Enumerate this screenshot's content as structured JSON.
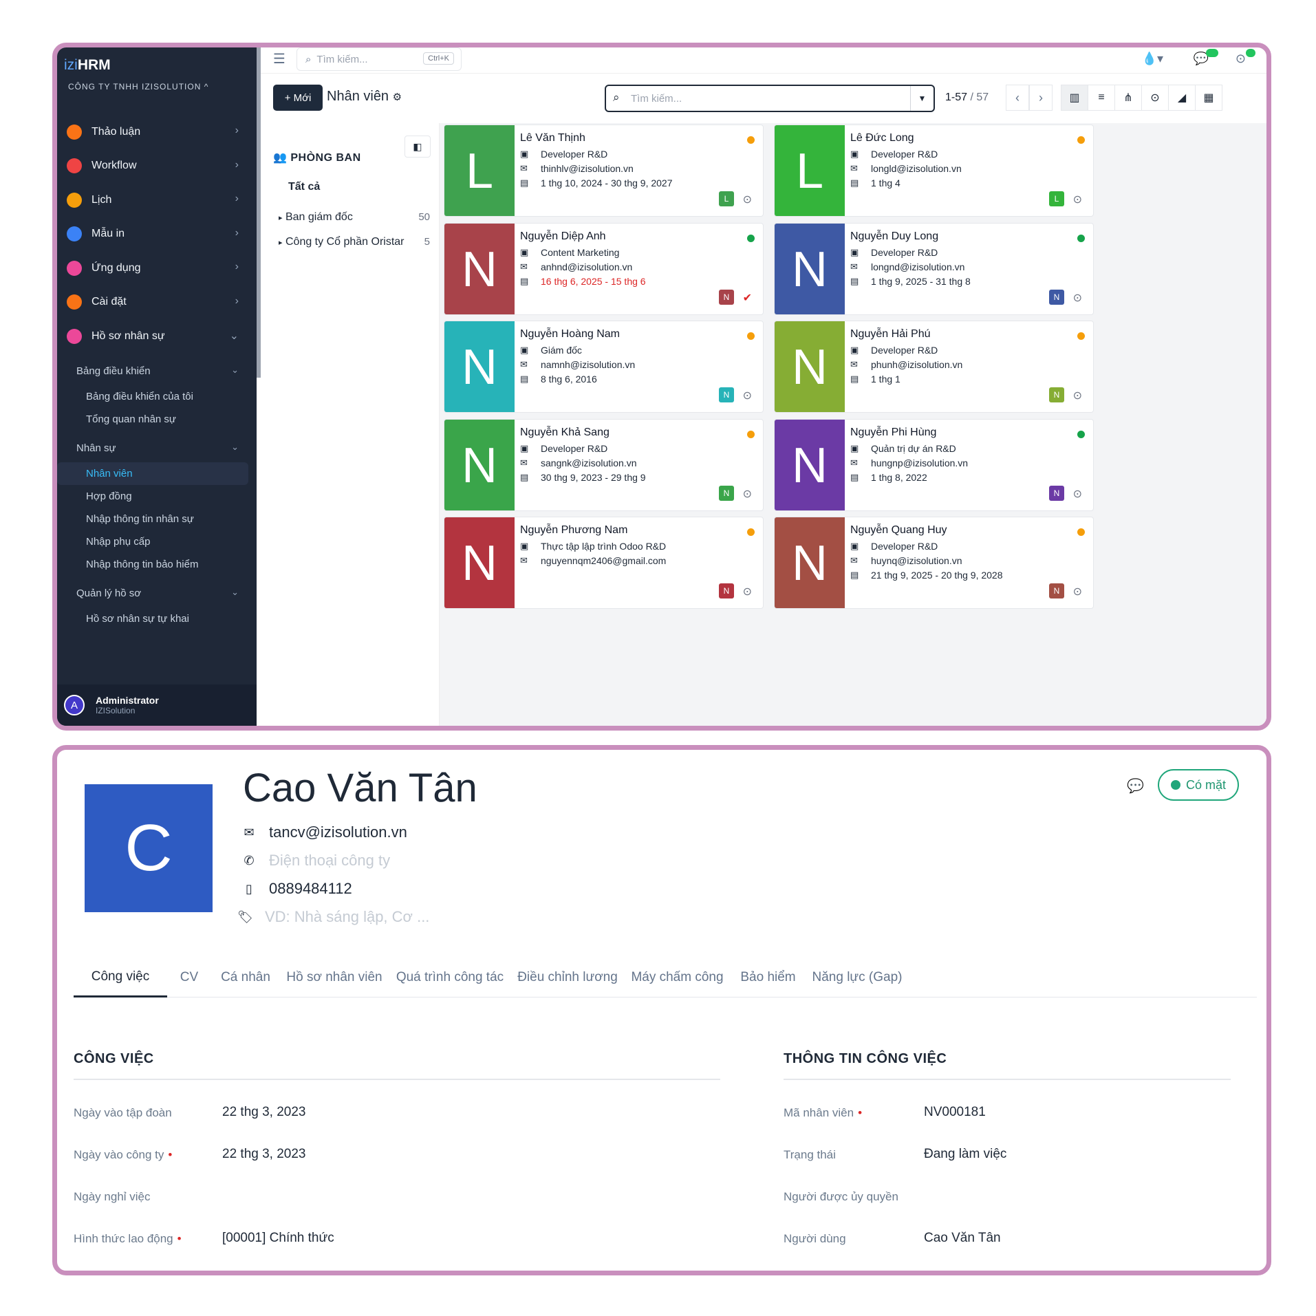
{
  "app": {
    "brand_prefix": "izi",
    "brand_suffix": "HRM",
    "company": "CÔNG TY TNHH IZISOLUTION ^"
  },
  "sidebar": {
    "items": [
      {
        "label": "Thảo luận",
        "icon": "discussion-icon",
        "color": "#f97316"
      },
      {
        "label": "Workflow",
        "icon": "workflow-icon",
        "color": "#ef4444"
      },
      {
        "label": "Lịch",
        "icon": "calendar-icon",
        "color": "#f59e0b"
      },
      {
        "label": "Mẫu in",
        "icon": "print-template-icon",
        "color": "#3b82f6"
      },
      {
        "label": "Ứng dụng",
        "icon": "apps-icon",
        "color": "#ec4899"
      },
      {
        "label": "Cài đặt",
        "icon": "settings-icon",
        "color": "#f97316"
      },
      {
        "label": "Hồ sơ nhân sự",
        "icon": "people-icon",
        "color": "#ec4899"
      }
    ],
    "dashboard_group": "Bảng điều khiển",
    "dashboard_items": [
      "Bảng điều khiển của tôi",
      "Tổng quan nhân sự"
    ],
    "hr_group": "Nhân sự",
    "hr_items": [
      "Nhân viên",
      "Hợp đồng",
      "Nhập thông tin nhân sự",
      "Nhập phụ cấp",
      "Nhập thông tin bảo hiểm"
    ],
    "records_group": "Quản lý hồ sơ",
    "records_items": [
      "Hồ sơ nhân sự tự khai"
    ],
    "user_name": "Administrator",
    "user_company": "IZISolution",
    "user_initial": "A"
  },
  "topbar": {
    "search_placeholder": "Tìm kiếm...",
    "shortcut": "Ctrl+K"
  },
  "control": {
    "new_label": "+ Mới",
    "breadcrumb": "Nhân viên",
    "search_placeholder": "Tìm kiếm...",
    "pager_range": "1-57",
    "pager_total": " / 57"
  },
  "departments": {
    "title": "PHÒNG BAN",
    "all_label": "Tất cả",
    "rows": [
      {
        "label": "Ban giám đốc",
        "count": "50"
      },
      {
        "label": "Công ty Cổ phần Oristar",
        "count": "5"
      }
    ]
  },
  "employees": [
    {
      "name": "Lê Văn Thịnh",
      "initial": "L",
      "job": "Developer R&D",
      "email": "thinhlv@izisolution.vn",
      "period": "1 thg 10, 2024 - 30 thg 9, 2027",
      "status_color": "#f59e0b",
      "avatar_color": "#3fa24f",
      "late": false
    },
    {
      "name": "Lê Đức Long",
      "initial": "L",
      "job": "Developer R&D",
      "email": "longld@izisolution.vn",
      "period": "1 thg 4",
      "status_color": "#f59e0b",
      "avatar_color": "#34b43b",
      "late": false
    },
    {
      "name": "Nguyễn Diệp Anh",
      "initial": "N",
      "job": "Content Marketing",
      "email": "anhnd@izisolution.vn",
      "period": "16 thg 6, 2025 - 15 thg 6",
      "status_color": "#16a34a",
      "avatar_color": "#a8434a",
      "late": true
    },
    {
      "name": "Nguyễn Duy Long",
      "initial": "N",
      "job": "Developer R&D",
      "email": "longnd@izisolution.vn",
      "period": "1 thg 9, 2025 - 31 thg 8",
      "status_color": "#16a34a",
      "avatar_color": "#3e59a4",
      "late": false
    },
    {
      "name": "Nguyễn Hoàng Nam",
      "initial": "N",
      "job": "Giám đốc",
      "email": "namnh@izisolution.vn",
      "period": "8 thg 6, 2016",
      "status_color": "#f59e0b",
      "avatar_color": "#27b3b8",
      "late": false
    },
    {
      "name": "Nguyễn Hải Phú",
      "initial": "N",
      "job": "Developer R&D",
      "email": "phunh@izisolution.vn",
      "period": "1 thg 1",
      "status_color": "#f59e0b",
      "avatar_color": "#86ad34",
      "late": false
    },
    {
      "name": "Nguyễn Khả Sang",
      "initial": "N",
      "job": "Developer R&D",
      "email": "sangnk@izisolution.vn",
      "period": "30 thg 9, 2023 - 29 thg 9",
      "status_color": "#f59e0b",
      "avatar_color": "#3aa54a",
      "late": false
    },
    {
      "name": "Nguyễn Phi Hùng",
      "initial": "N",
      "job": "Quản trị dự án R&D",
      "email": "hungnp@izisolution.vn",
      "period": "1 thg 8, 2022",
      "status_color": "#16a34a",
      "avatar_color": "#6b3aa5",
      "late": false
    },
    {
      "name": "Nguyễn Phương Nam",
      "initial": "N",
      "job": "Thực tập lập trình Odoo R&D",
      "email": "nguyennqm2406@gmail.com",
      "period": "",
      "status_color": "#f59e0b",
      "avatar_color": "#b3343f",
      "late": false
    },
    {
      "name": "Nguyễn Quang Huy",
      "initial": "N",
      "job": "Developer R&D",
      "email": "huynq@izisolution.vn",
      "period": "21 thg 9, 2025 - 20 thg 9, 2028",
      "status_color": "#f59e0b",
      "avatar_color": "#a34f44",
      "late": false
    }
  ],
  "form": {
    "initial": "C",
    "name": "Cao Văn Tân",
    "email": "tancv@izisolution.vn",
    "work_phone_placeholder": "Điện thoại công ty",
    "mobile": "0889484112",
    "tags_placeholder": "VD: Nhà sáng lập, Cơ ...",
    "presence": "Có mặt",
    "tabs": [
      "Công việc",
      "CV",
      "Cá nhân",
      "Hồ sơ nhân viên",
      "Quá trình công tác",
      "Điều chỉnh lương",
      "Máy chấm công",
      "Bảo hiểm",
      "Năng lực (Gap)"
    ],
    "left_section": "CÔNG VIỆC",
    "right_section": "THÔNG TIN CÔNG VIỆC",
    "left_fields": [
      {
        "label": "Ngày vào tập đoàn",
        "value": "22 thg 3, 2023",
        "required": false
      },
      {
        "label": "Ngày vào công ty",
        "value": "22 thg 3, 2023",
        "required": true
      },
      {
        "label": "Ngày nghỉ việc",
        "value": "",
        "required": false
      },
      {
        "label": "Hình thức lao động",
        "value": "[00001] Chính thức",
        "required": true
      }
    ],
    "right_fields": [
      {
        "label": "Mã nhân viên",
        "value": "NV000181",
        "required": true
      },
      {
        "label": "Trạng thái",
        "value": "Đang làm việc",
        "required": false
      },
      {
        "label": "Người được ủy quyền",
        "value": "",
        "required": false
      },
      {
        "label": "Người dùng",
        "value": "Cao Văn Tân",
        "required": false
      }
    ]
  }
}
